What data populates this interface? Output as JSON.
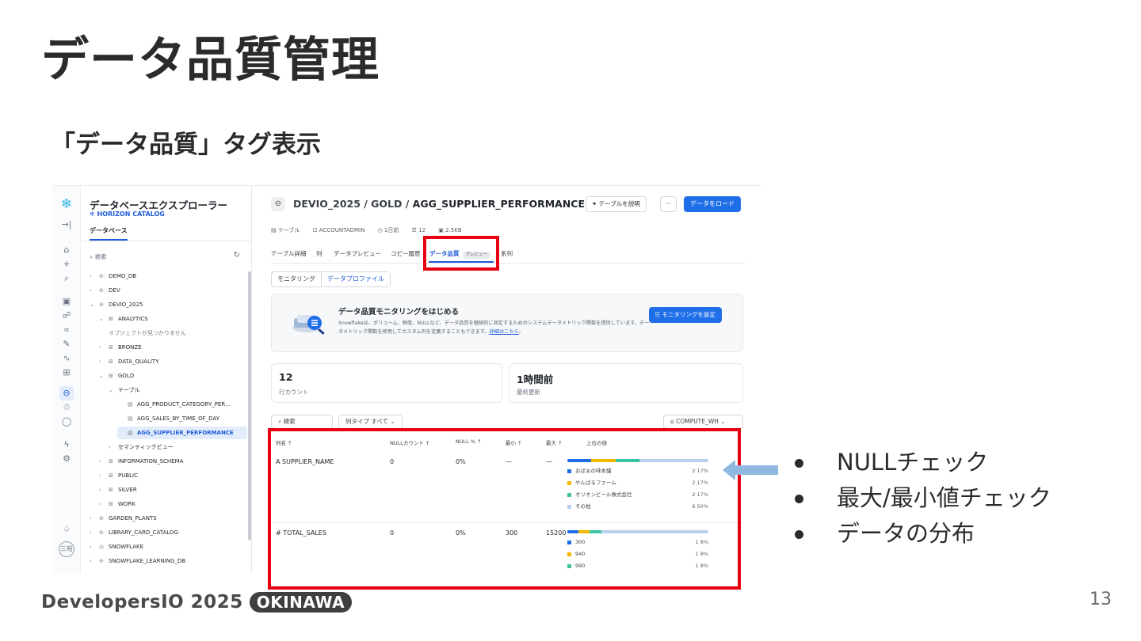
{
  "slide": {
    "title": "データ品質管理",
    "subtitle": "「データ品質」タグ表示",
    "bullets": [
      "NULLチェック",
      "最大/最小値チェック",
      "データの分布"
    ],
    "footer_logo_text": "DevelopersIO 2025",
    "footer_logo_pill": "OKINAWA",
    "page_number": "13"
  },
  "explorer": {
    "title": "データベースエクスプローラー",
    "subtitle": "HORIZON CATALOG",
    "tab": "データベース",
    "search_placeholder": "検索",
    "tree": [
      {
        "label": "DEMO_DB",
        "indent": 0,
        "icon": "db"
      },
      {
        "label": "DEV",
        "indent": 0,
        "icon": "db"
      },
      {
        "label": "DEVIO_2025",
        "indent": 0,
        "icon": "db",
        "open": true
      },
      {
        "label": "ANALYTICS",
        "indent": 1,
        "icon": "schema",
        "open": true
      },
      {
        "label": "オブジェクトが見つかりません",
        "indent": 2,
        "icon": "none",
        "muted": true
      },
      {
        "label": "BRONZE",
        "indent": 1,
        "icon": "schema"
      },
      {
        "label": "DATA_QUALITY",
        "indent": 1,
        "icon": "schema"
      },
      {
        "label": "GOLD",
        "indent": 1,
        "icon": "schema",
        "open": true
      },
      {
        "label": "テーブル",
        "indent": 2,
        "icon": "none",
        "open": true
      },
      {
        "label": "AGG_PRODUCT_CATEGORY_PER...",
        "indent": 3,
        "icon": "table"
      },
      {
        "label": "AGG_SALES_BY_TIME_OF_DAY",
        "indent": 3,
        "icon": "table"
      },
      {
        "label": "AGG_SUPPLIER_PERFORMANCE",
        "indent": 3,
        "icon": "table",
        "selected": true
      },
      {
        "label": "セマンティックビュー",
        "indent": 2,
        "icon": "none"
      },
      {
        "label": "INFORMATION_SCHEMA",
        "indent": 1,
        "icon": "schema"
      },
      {
        "label": "PUBLIC",
        "indent": 1,
        "icon": "schema"
      },
      {
        "label": "SILVER",
        "indent": 1,
        "icon": "schema"
      },
      {
        "label": "WORK",
        "indent": 1,
        "icon": "schema"
      },
      {
        "label": "GARDEN_PLANTS",
        "indent": 0,
        "icon": "db"
      },
      {
        "label": "LIBRARY_CARD_CATALOG",
        "indent": 0,
        "icon": "db"
      },
      {
        "label": "SNOWFLAKE",
        "indent": 0,
        "icon": "share"
      },
      {
        "label": "SNOWFLAKE_LEARNING_DB",
        "indent": 0,
        "icon": "db"
      }
    ],
    "rail_avatar": "三裕"
  },
  "main": {
    "breadcrumb_prefix": "DEVIO_2025 / GOLD / ",
    "breadcrumb_table": "AGG_SUPPLIER_PERFORMANCE",
    "btn_describe": "テーブルを説明",
    "btn_more": "···",
    "btn_load": "データをロード",
    "meta": {
      "type": "テーブル",
      "owner": "ACCOUNTADMIN",
      "age": "1日前",
      "columns": "12",
      "size": "2.5KB"
    },
    "tabs": [
      "テーブル詳細",
      "列",
      "データプレビュー",
      "コピー履歴",
      "データ品質",
      "系列"
    ],
    "tab_badge": "プレビュー",
    "segments": [
      "モニタリング",
      "データプロファイル"
    ],
    "info": {
      "title": "データ品質モニタリングをはじめる",
      "body": "Snowflakeは、ボリューム、鮮度、NULLなど、データ品質を継続的に測定するためのシステムデータメトリック関数を提供しています。データメトリック関数を使用してカスタム列を定義することもできます。",
      "link": "詳細はこちら",
      "button": "モニタリングを設定"
    },
    "stats": [
      {
        "value": "12",
        "label": "行カウント"
      },
      {
        "value": "1時間前",
        "label": "最終更新"
      }
    ],
    "filters": {
      "search": "検索",
      "coltype": "列タイプ  すべて",
      "warehouse": "COMPUTE_WH"
    },
    "table_headers": [
      "列名 ↑",
      "NULLカウント ↑",
      "NULL % ↑",
      "最小 ↑",
      "最大 ↑",
      "上位の値"
    ],
    "rows": [
      {
        "icon": "A",
        "name": "SUPPLIER_NAME",
        "null_count": "0",
        "null_pct": "0%",
        "min": "—",
        "max": "—",
        "top_values": [
          {
            "label": "おばぁの味本舗",
            "count": "2",
            "pct": "17%",
            "color": "#1e6ee8"
          },
          {
            "label": "やんばるファーム",
            "count": "2",
            "pct": "17%",
            "color": "#f5b800"
          },
          {
            "label": "オリオンビール株式会社",
            "count": "2",
            "pct": "17%",
            "color": "#3cc4a0"
          },
          {
            "label": "その他",
            "count": "6",
            "pct": "50%",
            "color": "#b9cff0"
          }
        ]
      },
      {
        "icon": "#",
        "name": "TOTAL_SALES",
        "null_count": "0",
        "null_pct": "0%",
        "min": "300",
        "max": "15200",
        "top_values": [
          {
            "label": "300",
            "count": "1",
            "pct": "8%",
            "color": "#1e6ee8"
          },
          {
            "label": "940",
            "count": "1",
            "pct": "8%",
            "color": "#f5b800"
          },
          {
            "label": "990",
            "count": "1",
            "pct": "8%",
            "color": "#3cc4a0"
          }
        ]
      }
    ]
  }
}
